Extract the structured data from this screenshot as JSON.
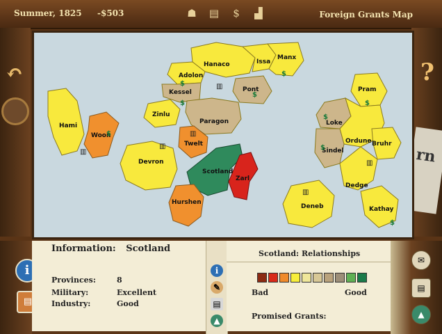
{
  "top": {
    "date": "Summer, 1825",
    "money": "-$503",
    "title": "Foreign Grants Map"
  },
  "provinces": [
    {
      "name": "Hanaco"
    },
    {
      "name": "Issa"
    },
    {
      "name": "Manx"
    },
    {
      "name": "Adolon"
    },
    {
      "name": "Kessel"
    },
    {
      "name": "Pont"
    },
    {
      "name": "Zinlu"
    },
    {
      "name": "Paragon"
    },
    {
      "name": "Hami"
    },
    {
      "name": "Woon"
    },
    {
      "name": "Twelt"
    },
    {
      "name": "Devron"
    },
    {
      "name": "Scotland"
    },
    {
      "name": "Zarl"
    },
    {
      "name": "Hurshen"
    },
    {
      "name": "Pram"
    },
    {
      "name": "Loke"
    },
    {
      "name": "Ordune"
    },
    {
      "name": "Bruhr"
    },
    {
      "name": "Sindel"
    },
    {
      "name": "Dedge"
    },
    {
      "name": "Deneb"
    },
    {
      "name": "Kathay"
    }
  ],
  "info": {
    "heading": "Information:",
    "name": "Scotland",
    "provinces_label": "Provinces:",
    "provinces_value": "8",
    "military_label": "Military:",
    "military_value": "Excellent",
    "industry_label": "Industry:",
    "industry_value": "Good"
  },
  "relationships": {
    "heading": "Scotland: Relationships",
    "bad": "Bad",
    "good": "Good",
    "promised": "Promised Grants:",
    "scale_colors": [
      "#8b2a12",
      "#d82a18",
      "#ef8a2a",
      "#f7ee3a",
      "#efe79a",
      "#d8c896",
      "#b9a27c",
      "#9c8e78",
      "#5fb054",
      "#1a7a4a"
    ]
  },
  "colors": {
    "ally": "#2f8a5c",
    "enemy": "#d8241c",
    "yellow": "#f8e93d",
    "orange": "#f0902e",
    "tan": "#cdb68b",
    "sea": "#c9d8df"
  }
}
